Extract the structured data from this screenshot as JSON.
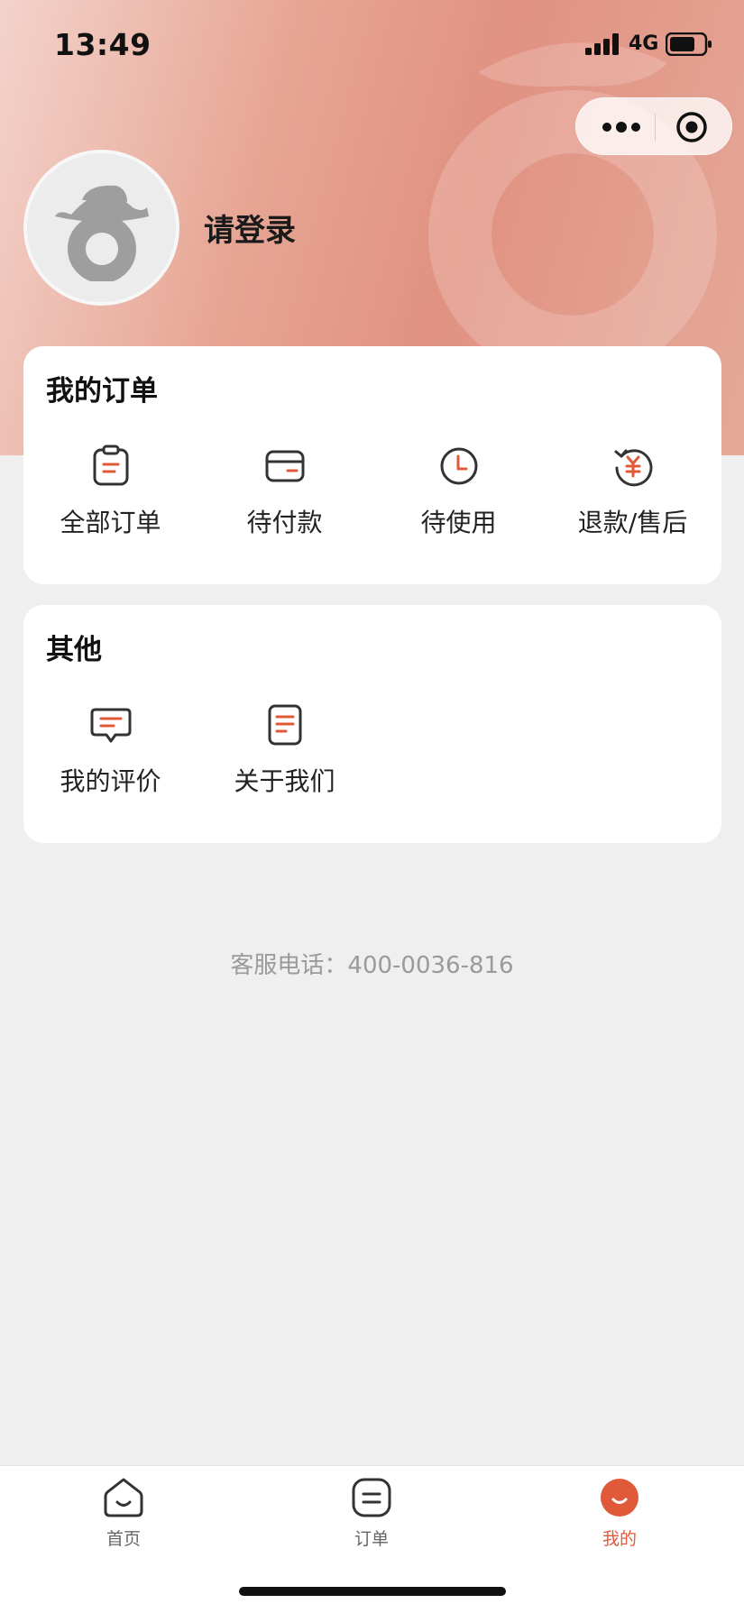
{
  "status_bar": {
    "time": "13:49",
    "network": "4G"
  },
  "profile": {
    "login_prompt": "请登录"
  },
  "orders_section": {
    "title": "我的订单",
    "items": [
      {
        "label": "全部订单",
        "icon": "clipboard-icon"
      },
      {
        "label": "待付款",
        "icon": "card-icon"
      },
      {
        "label": "待使用",
        "icon": "clock-icon"
      },
      {
        "label": "退款/售后",
        "icon": "refund-yen-icon"
      }
    ]
  },
  "other_section": {
    "title": "其他",
    "items": [
      {
        "label": "我的评价",
        "icon": "comment-icon"
      },
      {
        "label": "关于我们",
        "icon": "document-icon"
      }
    ]
  },
  "service_hotline": "客服电话：400-0036-816",
  "tabbar": {
    "items": [
      {
        "label": "首页",
        "icon": "home-smile-icon",
        "active": false
      },
      {
        "label": "订单",
        "icon": "order-list-icon",
        "active": false
      },
      {
        "label": "我的",
        "icon": "profile-smile-icon",
        "active": true
      }
    ]
  },
  "colors": {
    "accent": "#e05a3a",
    "header_gradient_start": "#f3d3cb",
    "header_gradient_end": "#e19282",
    "page_background": "#efefef"
  }
}
